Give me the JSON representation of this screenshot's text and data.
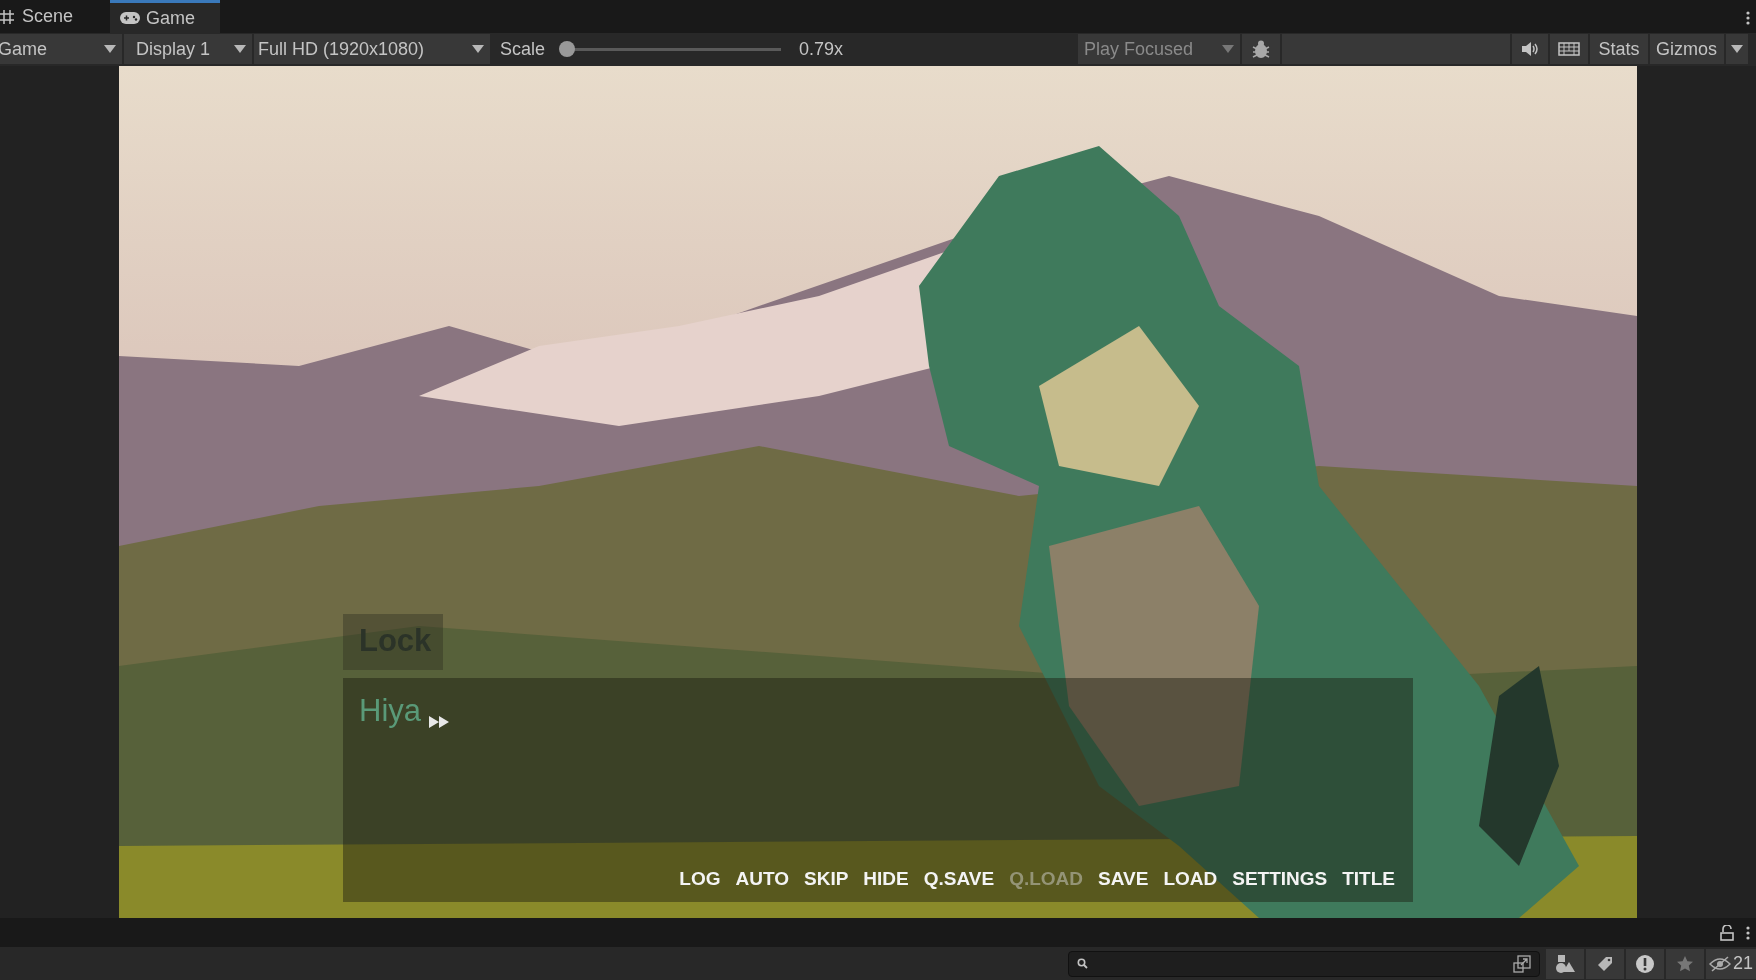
{
  "tabs": [
    {
      "label": "Scene",
      "kind": "scene",
      "selected": false
    },
    {
      "label": "Game",
      "kind": "game",
      "selected": true
    }
  ],
  "toolbar": {
    "view_mode": "Game",
    "display": "Display 1",
    "resolution": "Full HD (1920x1080)",
    "scale_label": "Scale",
    "scale": {
      "level": 0.0
    },
    "scale_reading": "0.79x",
    "play_mode": "Play Focused",
    "stats": "Stats",
    "gizmos": "Gizmos"
  },
  "game": {
    "speaker": "Lock",
    "line": "Hiya",
    "buttons": [
      {
        "label": "LOG",
        "disabled": false
      },
      {
        "label": "AUTO",
        "disabled": false
      },
      {
        "label": "SKIP",
        "disabled": false
      },
      {
        "label": "HIDE",
        "disabled": false
      },
      {
        "label": "Q.SAVE",
        "disabled": false
      },
      {
        "label": "Q.LOAD",
        "disabled": true
      },
      {
        "label": "SAVE",
        "disabled": false
      },
      {
        "label": "LOAD",
        "disabled": false
      },
      {
        "label": "SETTINGS",
        "disabled": false
      },
      {
        "label": "TITLE",
        "disabled": false
      }
    ]
  },
  "status_bar": {
    "hidden_count": "21"
  }
}
